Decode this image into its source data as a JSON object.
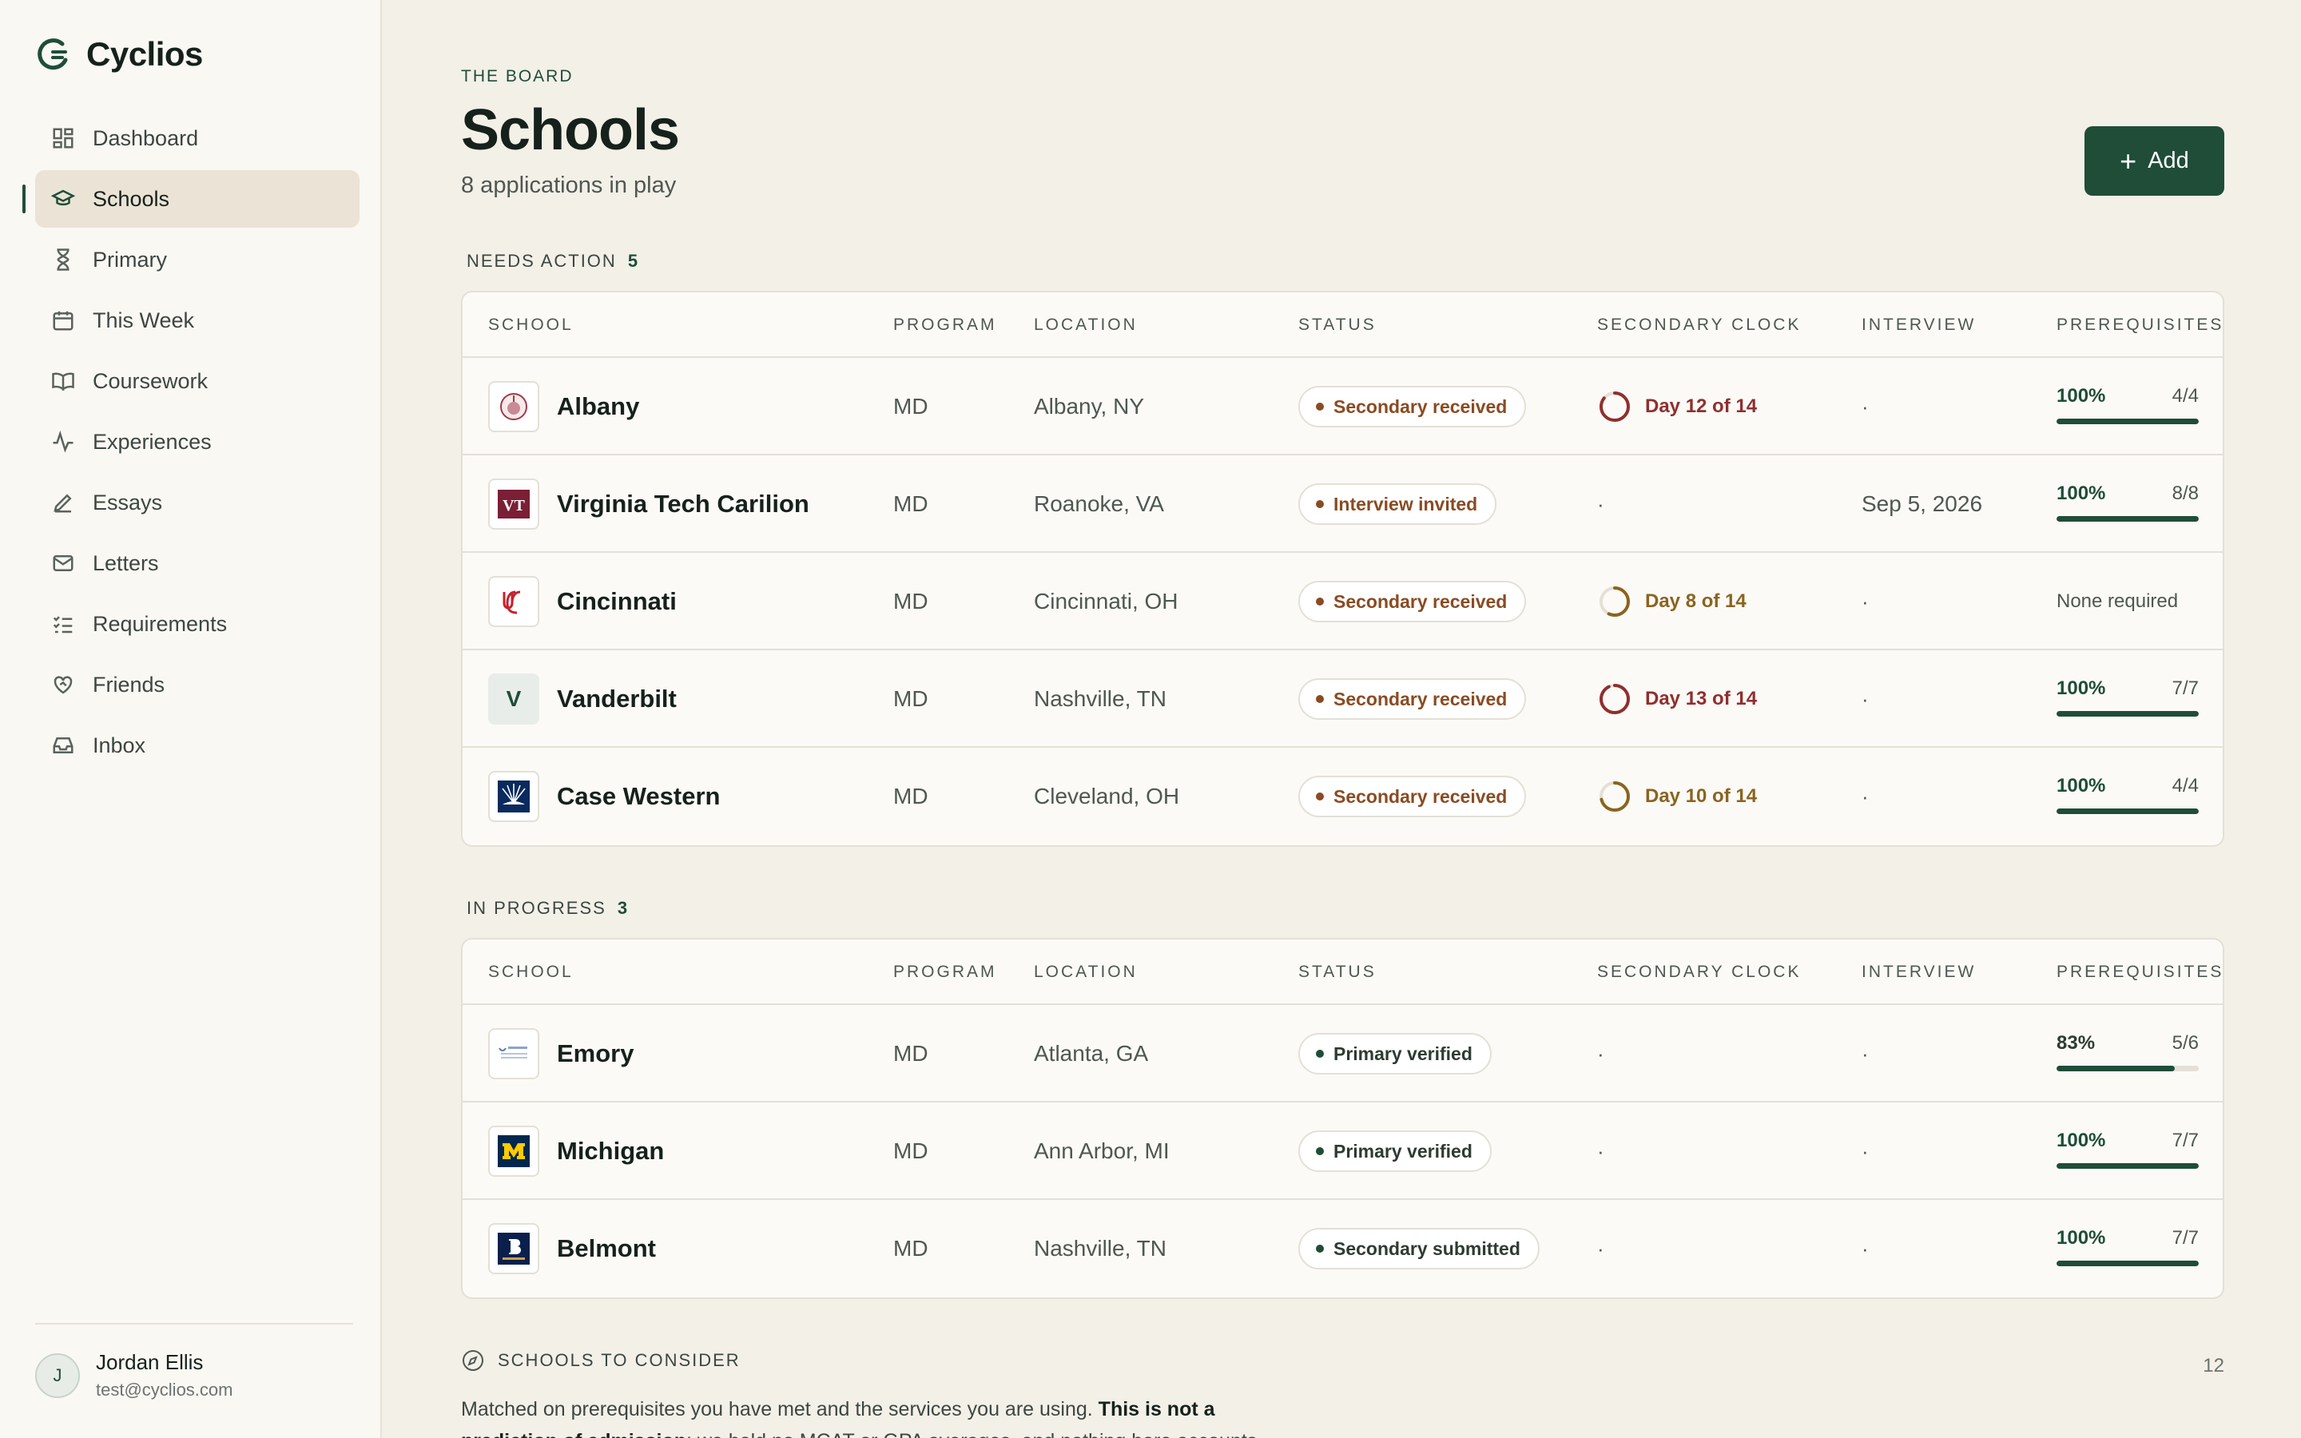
{
  "app": {
    "name": "Cyclios"
  },
  "sidebar": {
    "items": [
      {
        "label": "Dashboard",
        "icon": "grid-icon"
      },
      {
        "label": "Schools",
        "icon": "graduation-cap-icon",
        "active": true
      },
      {
        "label": "Primary",
        "icon": "hourglass-icon"
      },
      {
        "label": "This Week",
        "icon": "calendar-icon"
      },
      {
        "label": "Coursework",
        "icon": "book-icon"
      },
      {
        "label": "Experiences",
        "icon": "activity-icon"
      },
      {
        "label": "Essays",
        "icon": "pen-icon"
      },
      {
        "label": "Letters",
        "icon": "mail-icon"
      },
      {
        "label": "Requirements",
        "icon": "checklist-icon"
      },
      {
        "label": "Friends",
        "icon": "heart-handshake-icon"
      },
      {
        "label": "Inbox",
        "icon": "inbox-icon"
      }
    ],
    "user": {
      "initial": "J",
      "name": "Jordan Ellis",
      "email": "test@cyclios.com"
    }
  },
  "header": {
    "eyebrow": "THE BOARD",
    "title": "Schools",
    "subtitle": "8 applications in play",
    "add_label": "Add"
  },
  "columns": [
    "SCHOOL",
    "PROGRAM",
    "LOCATION",
    "STATUS",
    "SECONDARY CLOCK",
    "INTERVIEW",
    "PREREQUISITES"
  ],
  "needs_action": {
    "label": "NEEDS ACTION",
    "count": "5",
    "rows": [
      {
        "school": "Albany",
        "program": "MD",
        "location": "Albany, NY",
        "status": "Secondary received",
        "status_tone": "warn",
        "clock": "Day 12 of 14",
        "clock_fraction": 0.857,
        "clock_color": "#8f2f2f",
        "interview": "·",
        "prereq_pct": "100%",
        "prereq_frac": "4/4",
        "prereq_fill": 1.0
      },
      {
        "school": "Virginia Tech Carilion",
        "program": "MD",
        "location": "Roanoke, VA",
        "status": "Interview invited",
        "status_tone": "warn",
        "clock": "·",
        "interview": "Sep 5, 2026",
        "prereq_pct": "100%",
        "prereq_frac": "8/8",
        "prereq_fill": 1.0
      },
      {
        "school": "Cincinnati",
        "program": "MD",
        "location": "Cincinnati, OH",
        "status": "Secondary received",
        "status_tone": "warn",
        "clock": "Day 8 of 14",
        "clock_fraction": 0.571,
        "clock_color": "#8a6420",
        "interview": "·",
        "prereq_none": "None required"
      },
      {
        "school": "Vanderbilt",
        "program": "MD",
        "location": "Nashville, TN",
        "status": "Secondary received",
        "status_tone": "warn",
        "clock": "Day 13 of 14",
        "clock_fraction": 0.929,
        "clock_color": "#8f2f2f",
        "interview": "·",
        "prereq_pct": "100%",
        "prereq_frac": "7/7",
        "prereq_fill": 1.0
      },
      {
        "school": "Case Western",
        "program": "MD",
        "location": "Cleveland, OH",
        "status": "Secondary received",
        "status_tone": "warn",
        "clock": "Day 10 of 14",
        "clock_fraction": 0.714,
        "clock_color": "#8a6420",
        "interview": "·",
        "prereq_pct": "100%",
        "prereq_frac": "4/4",
        "prereq_fill": 1.0
      }
    ]
  },
  "in_progress": {
    "label": "IN PROGRESS",
    "count": "3",
    "rows": [
      {
        "school": "Emory",
        "program": "MD",
        "location": "Atlanta, GA",
        "status": "Primary verified",
        "status_tone": "ok",
        "clock": "·",
        "interview": "·",
        "prereq_pct": "83%",
        "prereq_frac": "5/6",
        "prereq_fill": 0.83
      },
      {
        "school": "Michigan",
        "program": "MD",
        "location": "Ann Arbor, MI",
        "status": "Primary verified",
        "status_tone": "ok",
        "clock": "·",
        "interview": "·",
        "prereq_pct": "100%",
        "prereq_frac": "7/7",
        "prereq_fill": 1.0
      },
      {
        "school": "Belmont",
        "program": "MD",
        "location": "Nashville, TN",
        "status": "Secondary submitted",
        "status_tone": "ok",
        "clock": "·",
        "interview": "·",
        "prereq_pct": "100%",
        "prereq_frac": "7/7",
        "prereq_fill": 1.0
      }
    ]
  },
  "consider": {
    "label": "SCHOOLS TO CONSIDER",
    "count": "12",
    "text_plain": "Matched on prerequisites you have met and the services you are using. ",
    "text_bold": "This is not a prediction of admission",
    "text_tail": "; we hold no MCAT or GPA averages, and nothing here accounts"
  }
}
